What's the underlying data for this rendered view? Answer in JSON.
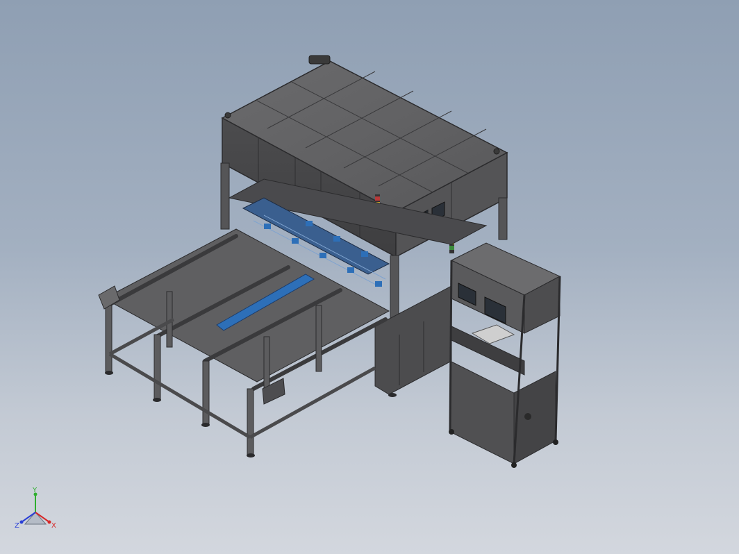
{
  "triad": {
    "y_label": "Y",
    "x_label": "X",
    "z_label": "Z",
    "colors": {
      "y": "#2fae2f",
      "x": "#d62828",
      "z": "#2a3fd6"
    }
  },
  "scene": {
    "background_top": "#8f9fb3",
    "background_bottom": "#d3d7de",
    "machine_color": "#5a5a5c",
    "accent_color": "#2d6fb8",
    "icons": [
      "machine-model",
      "conveyor",
      "control-cabinet",
      "signal-tower"
    ]
  }
}
